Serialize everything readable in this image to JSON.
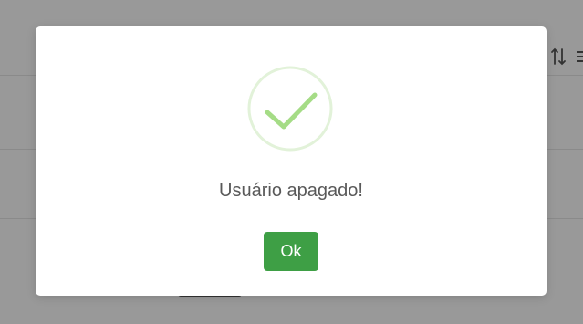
{
  "modal": {
    "title": "Usuário apagado!",
    "ok_label": "Ok",
    "icon": "check-circle-icon"
  },
  "background": {
    "icons": [
      "sort-icon",
      "menu-icon"
    ]
  },
  "colors": {
    "overlay": "#8c8c8c",
    "modal_bg": "#ffffff",
    "success_ring": "#e2f2d9",
    "success_check": "#a5dc86",
    "ok_button": "#3e9f45",
    "title_text": "#595959"
  }
}
